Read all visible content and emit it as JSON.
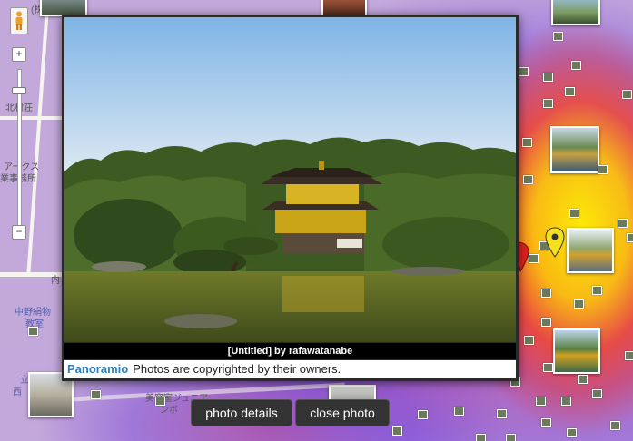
{
  "map": {
    "labels": {
      "l1": "(株",
      "l2": "北村荘",
      "l3": "アークス",
      "l4": "業事務所",
      "l5": "内",
      "l6": "中野絹物",
      "l7": "教室",
      "l8": "立",
      "l9": "西",
      "l10": "美容室ジュニア",
      "l11": "ンボ"
    }
  },
  "zoom": {
    "plus": "+",
    "minus": "−"
  },
  "photo": {
    "caption": "[Untitled] by rafawatanabe",
    "brand_logo": "Panoramio",
    "copyright": "Photos are copyrighted by their owners."
  },
  "buttons": {
    "details": "photo details",
    "close": "close photo"
  }
}
